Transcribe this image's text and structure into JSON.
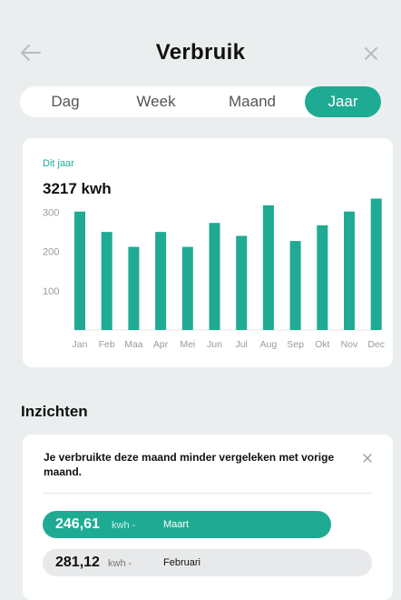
{
  "header": {
    "title": "Verbruik",
    "back_icon": "arrow-left-icon",
    "close_icon": "close-icon"
  },
  "tabs": [
    {
      "label": "Dag",
      "active": false
    },
    {
      "label": "Week",
      "active": false
    },
    {
      "label": "Maand",
      "active": false
    },
    {
      "label": "Jaar",
      "active": true
    }
  ],
  "summary": {
    "label": "Dit jaar",
    "value": "3217 kwh"
  },
  "chart_data": {
    "type": "bar",
    "categories": [
      "Jan",
      "Feb",
      "Maa",
      "Apr",
      "Mei",
      "Jun",
      "Jul",
      "Aug",
      "Sep",
      "Okt",
      "Nov",
      "Dec"
    ],
    "values": [
      302,
      250,
      212,
      250,
      212,
      273,
      240,
      318,
      227,
      267,
      302,
      335
    ],
    "yticks": [
      100,
      200,
      300
    ],
    "ylim": [
      0,
      350
    ],
    "grid": false,
    "bar_color": "#1fab93"
  },
  "insights": {
    "title": "Inzichten",
    "message": "Je verbruikte deze maand minder vergeleken met vorige maand.",
    "current": {
      "value": "246,61",
      "unit": "kwh -",
      "month": "Maart"
    },
    "previous": {
      "value": "281,12",
      "unit": "kwh -",
      "month": "Februari"
    }
  },
  "colors": {
    "accent": "#1fab93",
    "background": "#ebeeef"
  }
}
